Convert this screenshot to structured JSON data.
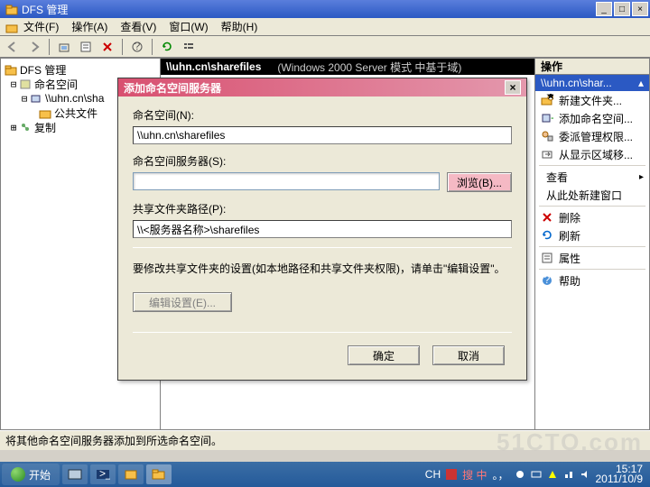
{
  "window": {
    "title": "DFS 管理",
    "btn_min": "_",
    "btn_max": "□",
    "btn_close": "×"
  },
  "menu": {
    "file": "文件(F)",
    "action": "操作(A)",
    "view": "查看(V)",
    "window": "窗口(W)",
    "help": "帮助(H)"
  },
  "tree": {
    "root": "DFS 管理",
    "ns": "命名空间",
    "server": "\\\\uhn.cn\\sha",
    "pub": "公共文件",
    "rep": "复制"
  },
  "pathbar": {
    "path": "\\\\uhn.cn\\sharefiles",
    "extra": "(Windows 2000 Server 模式 中基于域)"
  },
  "actions": {
    "header": "操作",
    "sub": "\\\\uhn.cn\\shar...",
    "sub_arrow": "▴",
    "items": [
      {
        "icon": "folder-new",
        "label": "新建文件夹...",
        "arrow": ""
      },
      {
        "icon": "server-add",
        "label": "添加命名空间...",
        "arrow": ""
      },
      {
        "icon": "delegate",
        "label": "委派管理权限...",
        "arrow": ""
      },
      {
        "icon": "move",
        "label": "从显示区域移...",
        "arrow": ""
      },
      {
        "icon": "",
        "label": "查看",
        "arrow": "▸"
      },
      {
        "icon": "",
        "label": "从此处新建窗口",
        "arrow": ""
      },
      {
        "icon": "delete",
        "label": "删除",
        "arrow": ""
      },
      {
        "icon": "refresh",
        "label": "刷新",
        "arrow": ""
      },
      {
        "icon": "props",
        "label": "属性",
        "arrow": ""
      },
      {
        "icon": "help",
        "label": "帮助",
        "arrow": ""
      }
    ]
  },
  "dialog": {
    "title": "添加命名空间服务器",
    "lbl_ns": "命名空间(N):",
    "val_ns": "\\\\uhn.cn\\sharefiles",
    "lbl_srv": "命名空间服务器(S):",
    "val_srv": "",
    "browse": "浏览(B)...",
    "lbl_share": "共享文件夹路径(P):",
    "val_share": "\\\\<服务器名称>\\sharefiles",
    "note": "要修改共享文件夹的设置(如本地路径和共享文件夹权限)，请单击\"编辑设置\"。",
    "edit": "编辑设置(E)...",
    "ok": "确定",
    "cancel": "取消",
    "close": "×"
  },
  "status": "将其他命名空间服务器添加到所选命名空间。",
  "taskbar": {
    "start": "开始",
    "ime": "CH",
    "ime2": "搜 中",
    "time": "15:17",
    "date": "2011/10/9"
  },
  "watermark": "51CTO.com"
}
